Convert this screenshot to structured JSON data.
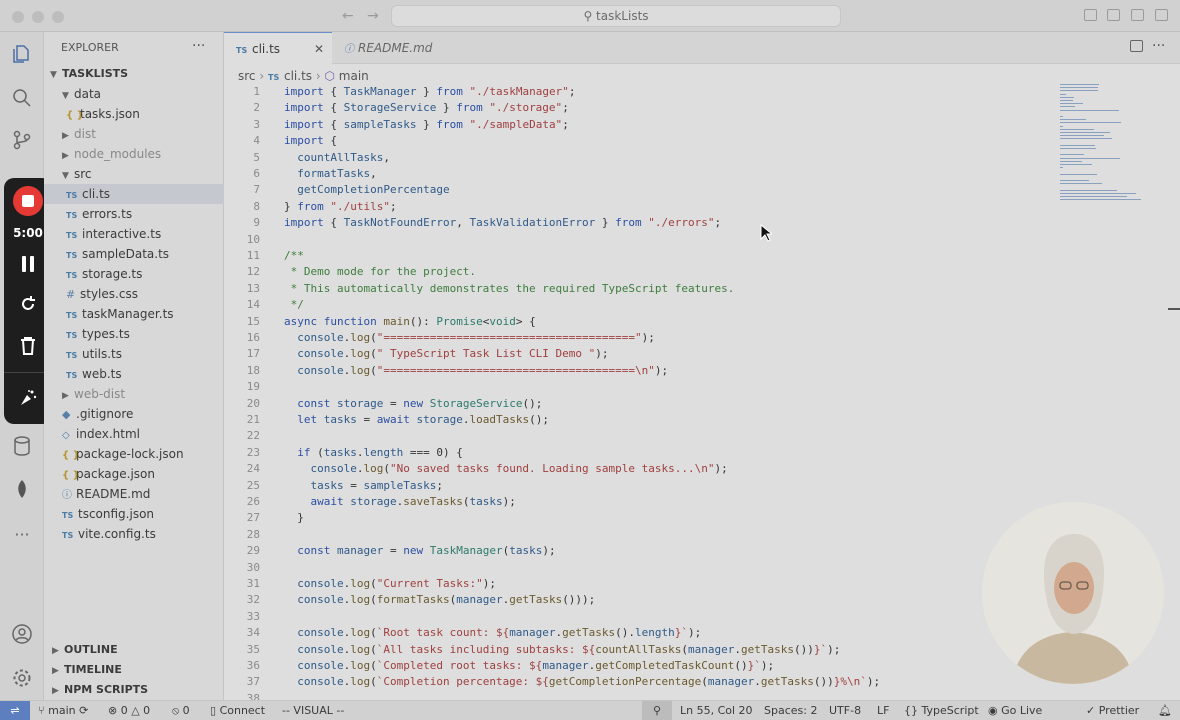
{
  "window": {
    "search_text": "taskLists"
  },
  "recording": {
    "time": "5:00"
  },
  "explorer": {
    "title": "EXPLORER",
    "root": "TASKLISTS",
    "tree": [
      {
        "label": "data",
        "kind": "folder-open",
        "depth": 1
      },
      {
        "label": "tasks.json",
        "kind": "json",
        "depth": 2
      },
      {
        "label": "dist",
        "kind": "folder",
        "depth": 1,
        "dim": true
      },
      {
        "label": "node_modules",
        "kind": "folder",
        "depth": 1,
        "dim": true
      },
      {
        "label": "src",
        "kind": "folder-open",
        "depth": 1
      },
      {
        "label": "cli.ts",
        "kind": "ts",
        "depth": 2,
        "selected": true
      },
      {
        "label": "errors.ts",
        "kind": "ts",
        "depth": 2
      },
      {
        "label": "interactive.ts",
        "kind": "ts",
        "depth": 2
      },
      {
        "label": "sampleData.ts",
        "kind": "ts",
        "depth": 2
      },
      {
        "label": "storage.ts",
        "kind": "ts",
        "depth": 2
      },
      {
        "label": "styles.css",
        "kind": "css",
        "depth": 2
      },
      {
        "label": "taskManager.ts",
        "kind": "ts",
        "depth": 2
      },
      {
        "label": "types.ts",
        "kind": "ts",
        "depth": 2
      },
      {
        "label": "utils.ts",
        "kind": "ts",
        "depth": 2
      },
      {
        "label": "web.ts",
        "kind": "ts",
        "depth": 2
      },
      {
        "label": "web-dist",
        "kind": "folder",
        "depth": 1,
        "dim": true
      },
      {
        "label": ".gitignore",
        "kind": "git",
        "depth": 1
      },
      {
        "label": "index.html",
        "kind": "html",
        "depth": 1
      },
      {
        "label": "package-lock.json",
        "kind": "json",
        "depth": 1
      },
      {
        "label": "package.json",
        "kind": "json",
        "depth": 1
      },
      {
        "label": "README.md",
        "kind": "md",
        "depth": 1
      },
      {
        "label": "tsconfig.json",
        "kind": "ts",
        "depth": 1
      },
      {
        "label": "vite.config.ts",
        "kind": "ts",
        "depth": 1
      }
    ],
    "sections": [
      "OUTLINE",
      "TIMELINE",
      "NPM SCRIPTS"
    ]
  },
  "tabs": [
    {
      "label": "cli.ts",
      "active": true
    },
    {
      "label": "README.md",
      "active": false
    }
  ],
  "breadcrumb": {
    "folder": "src",
    "file": "cli.ts",
    "symbol": "main"
  },
  "code_lines": [
    [
      [
        "kw",
        "import"
      ],
      [
        "",
        "{ "
      ],
      [
        "vr",
        "TaskManager"
      ],
      [
        "",
        " } "
      ],
      [
        "kw",
        "from"
      ],
      [
        "",
        " "
      ],
      [
        "str",
        "\"./taskManager\""
      ],
      [
        "",
        ";"
      ]
    ],
    [
      [
        "kw",
        "import"
      ],
      [
        "",
        "{ "
      ],
      [
        "vr",
        "StorageService"
      ],
      [
        "",
        " } "
      ],
      [
        "kw",
        "from"
      ],
      [
        "",
        " "
      ],
      [
        "str",
        "\"./storage\""
      ],
      [
        "",
        ";"
      ]
    ],
    [
      [
        "kw",
        "import"
      ],
      [
        "",
        "{ "
      ],
      [
        "vr",
        "sampleTasks"
      ],
      [
        "",
        " } "
      ],
      [
        "kw",
        "from"
      ],
      [
        "",
        " "
      ],
      [
        "str",
        "\"./sampleData\""
      ],
      [
        "",
        ";"
      ]
    ],
    [
      [
        "kw",
        "import"
      ],
      [
        "",
        "{"
      ]
    ],
    [
      [
        "",
        "  "
      ],
      [
        "vr",
        "countAllTasks"
      ],
      [
        "",
        ","
      ]
    ],
    [
      [
        "",
        "  "
      ],
      [
        "vr",
        "formatTasks"
      ],
      [
        "",
        ","
      ]
    ],
    [
      [
        "",
        "  "
      ],
      [
        "vr",
        "getCompletionPercentage"
      ]
    ],
    [
      [
        "",
        "} "
      ],
      [
        "kw",
        "from"
      ],
      [
        "",
        " "
      ],
      [
        "str",
        "\"./utils\""
      ],
      [
        "",
        ";"
      ]
    ],
    [
      [
        "kw",
        "import"
      ],
      [
        "",
        "{ "
      ],
      [
        "vr",
        "TaskNotFoundError"
      ],
      [
        "",
        ", "
      ],
      [
        "vr",
        "TaskValidationError"
      ],
      [
        "",
        " } "
      ],
      [
        "kw",
        "from"
      ],
      [
        "",
        " "
      ],
      [
        "str",
        "\"./errors\""
      ],
      [
        "",
        ";"
      ]
    ],
    [],
    [
      [
        "cm",
        "/**"
      ]
    ],
    [
      [
        "cm",
        " * Demo mode for the project."
      ]
    ],
    [
      [
        "cm",
        " * This automatically demonstrates the required TypeScript features."
      ]
    ],
    [
      [
        "cm",
        " */"
      ]
    ],
    [
      [
        "kw",
        "async function"
      ],
      [
        "",
        " "
      ],
      [
        "fn",
        "main"
      ],
      [
        "",
        "(): "
      ],
      [
        "ty",
        "Promise"
      ],
      [
        "",
        "<"
      ],
      [
        "ty",
        "void"
      ],
      [
        "",
        "> {"
      ]
    ],
    [
      [
        "",
        "  "
      ],
      [
        "vr",
        "console"
      ],
      [
        "",
        "."
      ],
      [
        "fn",
        "log"
      ],
      [
        "",
        "("
      ],
      [
        "str",
        "\"======================================\""
      ],
      [
        "",
        ");"
      ]
    ],
    [
      [
        "",
        "  "
      ],
      [
        "vr",
        "console"
      ],
      [
        "",
        "."
      ],
      [
        "fn",
        "log"
      ],
      [
        "",
        "("
      ],
      [
        "str",
        "\" TypeScript Task List CLI Demo \""
      ],
      [
        "",
        ");"
      ]
    ],
    [
      [
        "",
        "  "
      ],
      [
        "vr",
        "console"
      ],
      [
        "",
        "."
      ],
      [
        "fn",
        "log"
      ],
      [
        "",
        "("
      ],
      [
        "str",
        "\"======================================\\n\""
      ],
      [
        "",
        ");"
      ]
    ],
    [],
    [
      [
        "",
        "  "
      ],
      [
        "kw",
        "const"
      ],
      [
        "",
        " "
      ],
      [
        "vr",
        "storage"
      ],
      [
        "",
        " = "
      ],
      [
        "kw",
        "new"
      ],
      [
        "",
        " "
      ],
      [
        "ty",
        "StorageService"
      ],
      [
        "",
        "();"
      ]
    ],
    [
      [
        "",
        "  "
      ],
      [
        "kw",
        "let"
      ],
      [
        "",
        " "
      ],
      [
        "vr",
        "tasks"
      ],
      [
        "",
        " = "
      ],
      [
        "kw",
        "await"
      ],
      [
        "",
        " "
      ],
      [
        "vr",
        "storage"
      ],
      [
        "",
        "."
      ],
      [
        "fn",
        "loadTasks"
      ],
      [
        "",
        "();"
      ]
    ],
    [],
    [
      [
        "",
        "  "
      ],
      [
        "kw",
        "if"
      ],
      [
        "",
        " ("
      ],
      [
        "vr",
        "tasks"
      ],
      [
        "",
        "."
      ],
      [
        "vr",
        "length"
      ],
      [
        "",
        " === "
      ],
      [
        "",
        "0"
      ],
      [
        "",
        ") {"
      ]
    ],
    [
      [
        "",
        "    "
      ],
      [
        "vr",
        "console"
      ],
      [
        "",
        "."
      ],
      [
        "fn",
        "log"
      ],
      [
        "",
        "("
      ],
      [
        "str",
        "\"No saved tasks found. Loading sample tasks...\\n\""
      ],
      [
        "",
        ");"
      ]
    ],
    [
      [
        "",
        "    "
      ],
      [
        "vr",
        "tasks"
      ],
      [
        "",
        " = "
      ],
      [
        "vr",
        "sampleTasks"
      ],
      [
        "",
        ";"
      ]
    ],
    [
      [
        "",
        "    "
      ],
      [
        "kw",
        "await"
      ],
      [
        "",
        " "
      ],
      [
        "vr",
        "storage"
      ],
      [
        "",
        "."
      ],
      [
        "fn",
        "saveTasks"
      ],
      [
        "",
        "("
      ],
      [
        "vr",
        "tasks"
      ],
      [
        "",
        ");"
      ]
    ],
    [
      [
        "",
        "  }"
      ]
    ],
    [],
    [
      [
        "",
        "  "
      ],
      [
        "kw",
        "const"
      ],
      [
        "",
        " "
      ],
      [
        "vr",
        "manager"
      ],
      [
        "",
        " = "
      ],
      [
        "kw",
        "new"
      ],
      [
        "",
        " "
      ],
      [
        "ty",
        "TaskManager"
      ],
      [
        "",
        "("
      ],
      [
        "vr",
        "tasks"
      ],
      [
        "",
        ");"
      ]
    ],
    [],
    [
      [
        "",
        "  "
      ],
      [
        "vr",
        "console"
      ],
      [
        "",
        "."
      ],
      [
        "fn",
        "log"
      ],
      [
        "",
        "("
      ],
      [
        "str",
        "\"Current Tasks:\""
      ],
      [
        "",
        ");"
      ]
    ],
    [
      [
        "",
        "  "
      ],
      [
        "vr",
        "console"
      ],
      [
        "",
        "."
      ],
      [
        "fn",
        "log"
      ],
      [
        "",
        "("
      ],
      [
        "fn",
        "formatTasks"
      ],
      [
        "",
        "("
      ],
      [
        "vr",
        "manager"
      ],
      [
        "",
        "."
      ],
      [
        "fn",
        "getTasks"
      ],
      [
        "",
        "()));"
      ]
    ],
    [],
    [
      [
        "",
        "  "
      ],
      [
        "vr",
        "console"
      ],
      [
        "",
        "."
      ],
      [
        "fn",
        "log"
      ],
      [
        "",
        "("
      ],
      [
        "str",
        "`Root task count: ${"
      ],
      [
        "vr",
        "manager"
      ],
      [
        "",
        "."
      ],
      [
        "fn",
        "getTasks"
      ],
      [
        "",
        "()."
      ],
      [
        "vr",
        "length"
      ],
      [
        "str",
        "}`"
      ],
      [
        "",
        ");"
      ]
    ],
    [
      [
        "",
        "  "
      ],
      [
        "vr",
        "console"
      ],
      [
        "",
        "."
      ],
      [
        "fn",
        "log"
      ],
      [
        "",
        "("
      ],
      [
        "str",
        "`All tasks including subtasks: ${"
      ],
      [
        "fn",
        "countAllTasks"
      ],
      [
        "",
        "("
      ],
      [
        "vr",
        "manager"
      ],
      [
        "",
        "."
      ],
      [
        "fn",
        "getTasks"
      ],
      [
        "",
        "())"
      ],
      [
        "str",
        "}`"
      ],
      [
        "",
        ");"
      ]
    ],
    [
      [
        "",
        "  "
      ],
      [
        "vr",
        "console"
      ],
      [
        "",
        "."
      ],
      [
        "fn",
        "log"
      ],
      [
        "",
        "("
      ],
      [
        "str",
        "`Completed root tasks: ${"
      ],
      [
        "vr",
        "manager"
      ],
      [
        "",
        "."
      ],
      [
        "fn",
        "getCompletedTaskCount"
      ],
      [
        "",
        "()"
      ],
      [
        "str",
        "}`"
      ],
      [
        "",
        ");"
      ]
    ],
    [
      [
        "",
        "  "
      ],
      [
        "vr",
        "console"
      ],
      [
        "",
        "."
      ],
      [
        "fn",
        "log"
      ],
      [
        "",
        "("
      ],
      [
        "str",
        "`Completion percentage: ${"
      ],
      [
        "fn",
        "getCompletionPercentage"
      ],
      [
        "",
        "("
      ],
      [
        "vr",
        "manager"
      ],
      [
        "",
        "."
      ],
      [
        "fn",
        "getTasks"
      ],
      [
        "",
        "())"
      ],
      [
        "str",
        "}%\\n`"
      ],
      [
        "",
        ");"
      ]
    ],
    []
  ],
  "status": {
    "branch": "main",
    "errors": "0",
    "warnings": "0",
    "ports": "0",
    "connect": "Connect",
    "mode": "-- VISUAL --",
    "position": "Ln 55, Col 20",
    "spaces": "Spaces: 2",
    "encoding": "UTF-8",
    "eol": "LF",
    "language": "TypeScript",
    "golive": "Go Live",
    "prettier": "Prettier"
  }
}
